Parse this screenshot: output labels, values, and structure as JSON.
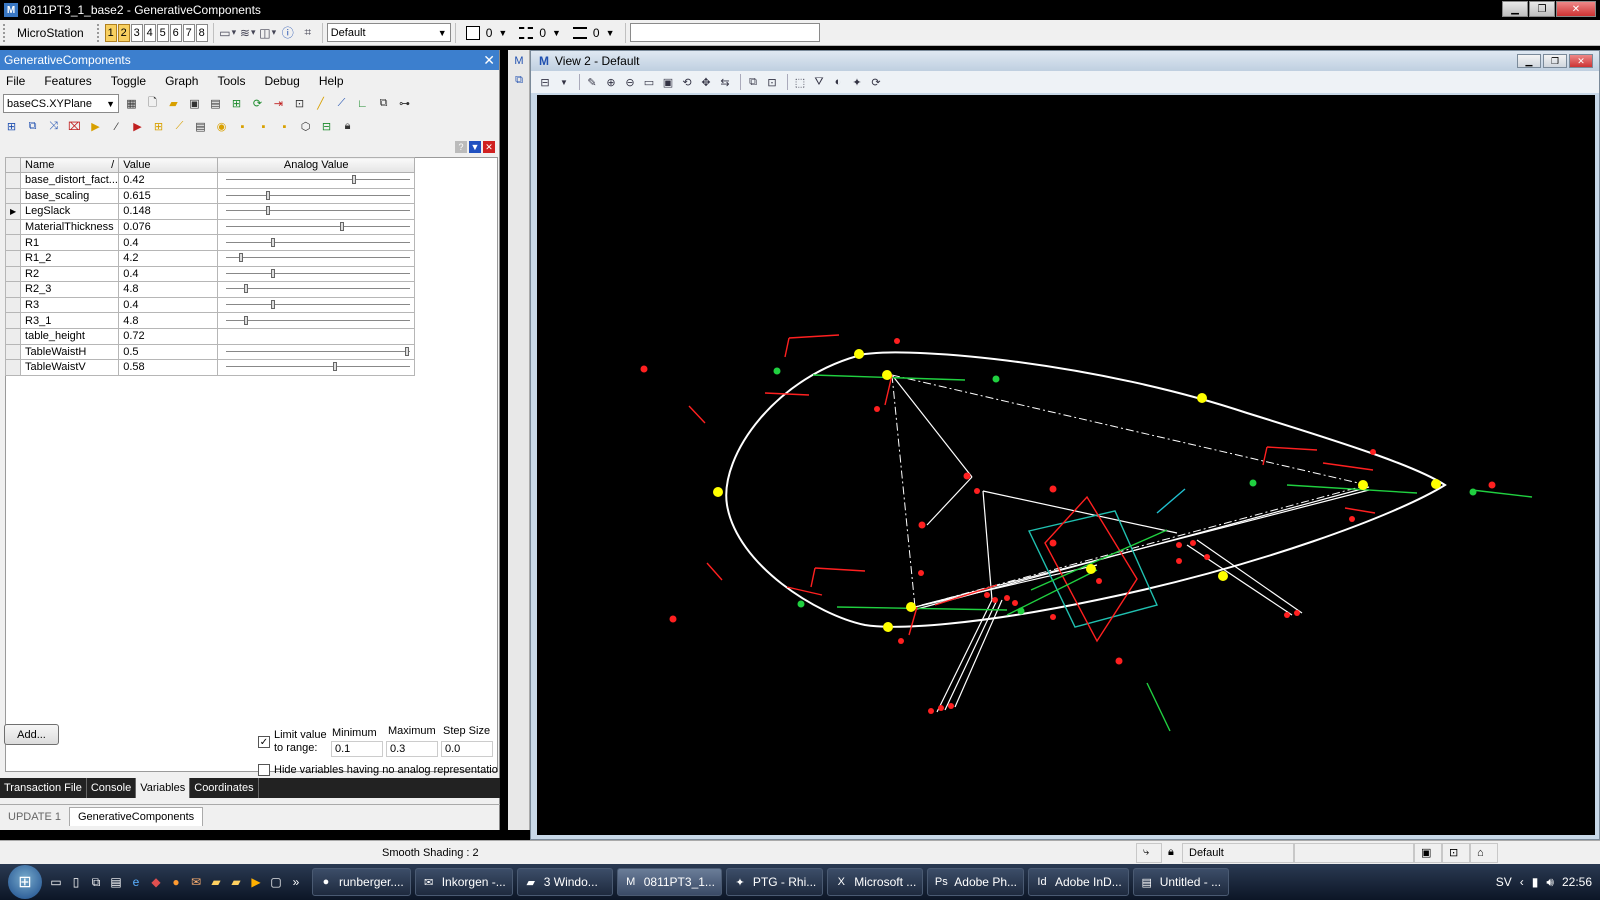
{
  "window": {
    "title": "0811PT3_1_base2 - GenerativeComponents",
    "app_icon": "microstation-icon"
  },
  "main_toolbar": {
    "label": "MicroStation",
    "view_buttons": [
      "1",
      "2",
      "3",
      "4",
      "5",
      "6",
      "7",
      "8"
    ],
    "active_views": [
      "1",
      "2"
    ],
    "level_combo": "Default",
    "color_value": "0",
    "style_value": "0",
    "weight_value": "0",
    "search_value": ""
  },
  "gc_panel": {
    "title": "GenerativeComponents",
    "menu": [
      "File",
      "Features",
      "Toggle",
      "Graph",
      "Tools",
      "Debug",
      "Help"
    ],
    "cs_combo": "baseCS.XYPlane",
    "table": {
      "headers": {
        "name": "Name",
        "sort": "/",
        "value": "Value",
        "analog": "Analog Value"
      },
      "rows": [
        {
          "name": "base_distort_fact...",
          "value": "0.42",
          "slider": 0.7,
          "marker": ""
        },
        {
          "name": "base_scaling",
          "value": "0.615",
          "slider": 0.22,
          "marker": ""
        },
        {
          "name": "LegSlack",
          "value": "0.148",
          "slider": 0.22,
          "marker": "▶"
        },
        {
          "name": "MaterialThickness",
          "value": "0.076",
          "slider": 0.63,
          "marker": ""
        },
        {
          "name": "R1",
          "value": "0.4",
          "slider": 0.25,
          "marker": ""
        },
        {
          "name": "R1_2",
          "value": "4.2",
          "slider": 0.07,
          "marker": ""
        },
        {
          "name": "R2",
          "value": "0.4",
          "slider": 0.25,
          "marker": ""
        },
        {
          "name": "R2_3",
          "value": "4.8",
          "slider": 0.1,
          "marker": ""
        },
        {
          "name": "R3",
          "value": "0.4",
          "slider": 0.25,
          "marker": ""
        },
        {
          "name": "R3_1",
          "value": "4.8",
          "slider": 0.1,
          "marker": ""
        },
        {
          "name": "table_height",
          "value": "0.72",
          "slider": null,
          "marker": ""
        },
        {
          "name": "TableWaistH",
          "value": "0.5",
          "slider": 0.99,
          "marker": ""
        },
        {
          "name": "TableWaistV",
          "value": "0.58",
          "slider": 0.59,
          "marker": ""
        }
      ]
    },
    "add_label": "Add...",
    "range": {
      "limit_label_1": "Limit value",
      "limit_label_2": "to range:",
      "min_label": "Minimum",
      "max_label": "Maximum",
      "step_label": "Step Size",
      "min": "0.1",
      "max": "0.3",
      "step": "0.0",
      "hide_label": "Hide variables having no analog representatio"
    },
    "tabs": [
      "Transaction File",
      "Console",
      "Variables",
      "Coordinates"
    ],
    "active_tab": "Variables",
    "lower_tabs": [
      "UPDATE 1",
      "GenerativeComponents"
    ]
  },
  "view2": {
    "title": "View 2 - Default"
  },
  "status": {
    "message": "Smooth Shading : 2",
    "level": "Default"
  },
  "taskbar": {
    "tasks": [
      {
        "label": "runberger....",
        "icon": "firefox-icon"
      },
      {
        "label": "Inkorgen -...",
        "icon": "mail-icon"
      },
      {
        "label": "3 Windo...",
        "icon": "folder-icon"
      },
      {
        "label": "0811PT3_1...",
        "icon": "microstation-icon",
        "active": true
      },
      {
        "label": "PTG - Rhi...",
        "icon": "rhino-icon"
      },
      {
        "label": "Microsoft ...",
        "icon": "excel-icon"
      },
      {
        "label": "Adobe Ph...",
        "icon": "photoshop-icon"
      },
      {
        "label": "Adobe InD...",
        "icon": "indesign-icon"
      },
      {
        "label": "Untitled - ...",
        "icon": "notepad-icon"
      }
    ],
    "lang": "SV",
    "time": "22:56"
  },
  "colors": {
    "selection": "#3c7fce",
    "canvas": "#000000",
    "curve": "#ffffff",
    "point": "#ffff00",
    "red": "#ff2020",
    "green": "#20d040",
    "cyan": "#20c0b0"
  }
}
